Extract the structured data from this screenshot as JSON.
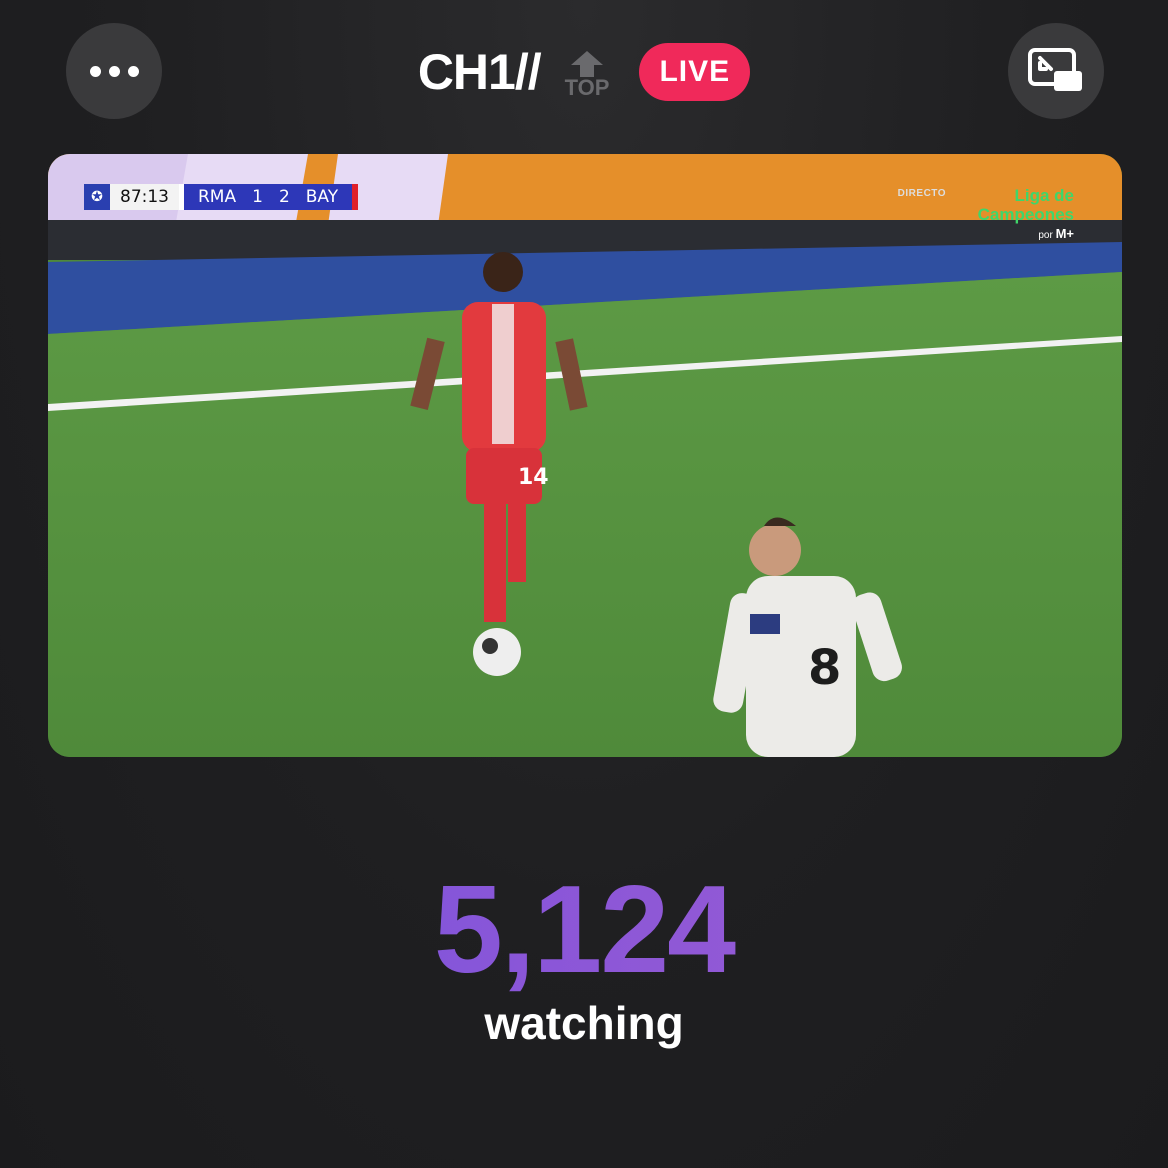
{
  "header": {
    "channel_name": "CH1//",
    "top_label": "TOP",
    "live_label": "LIVE",
    "more_icon": "ellipsis-icon",
    "pip_icon": "picture-in-picture-exit-icon"
  },
  "video": {
    "scoreboard": {
      "match_time": "87:13",
      "home_team": "RMA",
      "home_score": "1",
      "away_score": "2",
      "away_team": "BAY"
    },
    "broadcast": {
      "directo": "DIRECTO",
      "competition_line1": "Liga de",
      "competition_line2": "Campeones",
      "por": "por",
      "network": "M+"
    },
    "player_numbers": {
      "red_player": "14",
      "white_player": "8"
    }
  },
  "viewers": {
    "count": "5,124",
    "label": "watching"
  },
  "colors": {
    "live_badge": "#f0295a",
    "count_gradient_start": "#6b52e0",
    "count_gradient_end": "#a05fd0",
    "button_bg": "#3a3a3c"
  }
}
